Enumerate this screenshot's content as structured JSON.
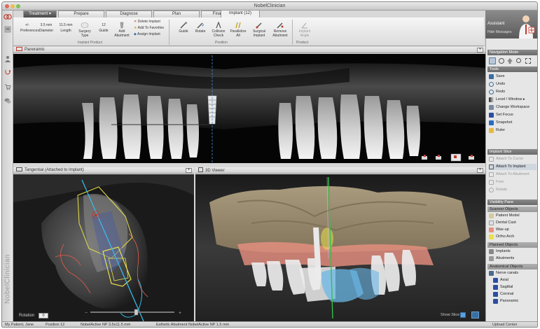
{
  "window": {
    "title": "NobelClinician"
  },
  "tabs": [
    {
      "label": "Treatment",
      "dark": true
    },
    {
      "label": "Prepare"
    },
    {
      "label": "Diagnose"
    },
    {
      "label": "Plan"
    },
    {
      "label": "Finalize"
    },
    {
      "label": "Implant (12)",
      "active": true
    }
  ],
  "ribbon": {
    "items": [
      {
        "label": "Preferences"
      },
      {
        "label": "Diameter",
        "value": "3.5 mm"
      },
      {
        "label": "Length",
        "value": "11.5 mm"
      },
      {
        "label": "Surgery Type"
      },
      {
        "label": "Guide",
        "value": "12"
      },
      {
        "label": "Add Abutment"
      },
      {
        "label": "Delete Implant"
      },
      {
        "label": "Add To Favorites"
      },
      {
        "label": "Assign Implant"
      },
      {
        "label": "Guide"
      },
      {
        "label": "Rotate"
      },
      {
        "label": "Collision Check"
      },
      {
        "label": "Parallelize All"
      },
      {
        "label": "Surgical Implant"
      },
      {
        "label": "Remove Abutment"
      },
      {
        "label": "Implant Angle"
      }
    ],
    "groups": [
      "Implant Product",
      "Position",
      "Product"
    ]
  },
  "assistant": {
    "title": "Assistant",
    "button": "Hide Messages"
  },
  "panels": {
    "panoramic": {
      "title": "Panoramic"
    },
    "tangential": {
      "title": "Tangential (Attached to Implant)",
      "rotation_label": "Rotation",
      "rotation_value": "0"
    },
    "view3d": {
      "title": "3D Viewer",
      "show_slice": "Show Slice"
    }
  },
  "navigation": {
    "title": "Navigation Mode"
  },
  "tools": {
    "title": "Tools",
    "items": [
      {
        "label": "Save",
        "icon": "save-icon"
      },
      {
        "label": "Undo",
        "icon": "undo-icon"
      },
      {
        "label": "Redo",
        "icon": "redo-icon"
      },
      {
        "label": "Level / Window",
        "icon": "level-window-icon"
      },
      {
        "label": "Change Workspace",
        "icon": "workspace-icon"
      },
      {
        "label": "Set Focus",
        "icon": "focus-icon"
      },
      {
        "label": "Snapshot",
        "icon": "snapshot-icon"
      },
      {
        "label": "Ruler",
        "icon": "ruler-icon"
      }
    ]
  },
  "implant_slice": {
    "title": "Implant Slice",
    "items": [
      {
        "label": "Attach To Curve",
        "dim": true
      },
      {
        "label": "Attach To Implant",
        "highlighted": true
      },
      {
        "label": "Attach To Abutment",
        "dim": true
      },
      {
        "label": "Free",
        "dim": true
      },
      {
        "label": "Rotate",
        "dim": true
      }
    ]
  },
  "visibility": {
    "title": "Visibility Pane",
    "groups": [
      {
        "name": "Scanner Objects",
        "items": [
          "Patient Model",
          "Dental Cast",
          "Wax-up",
          "Ortho Arch"
        ]
      },
      {
        "name": "Planned Objects",
        "items": [
          "Implants",
          "Abutments"
        ]
      },
      {
        "name": "Anatomical Objects",
        "items": [
          "Nerve canals",
          "Axial",
          "Sagittal",
          "Coronal",
          "Panoramic"
        ]
      }
    ]
  },
  "status": {
    "patient": "My Patient, Jane",
    "position": "Position 12",
    "implant": "NobelActive NP 3.5x11.5 mm",
    "abutment": "Esthetic Abutment NobelActive NP 1.5 mm",
    "right": "Upload Center"
  },
  "brand": {
    "vertical_text": "NobelClinician"
  },
  "colors": {
    "accent": "#1e8fd6",
    "implant_yellow": "#e8e04a",
    "guide_blue": "#38b8e8",
    "nerve_red": "#d85a4a",
    "axis_green": "#36c04a",
    "crown_blue": "#6ab8e6",
    "gingiva_pink": "#e89080"
  }
}
